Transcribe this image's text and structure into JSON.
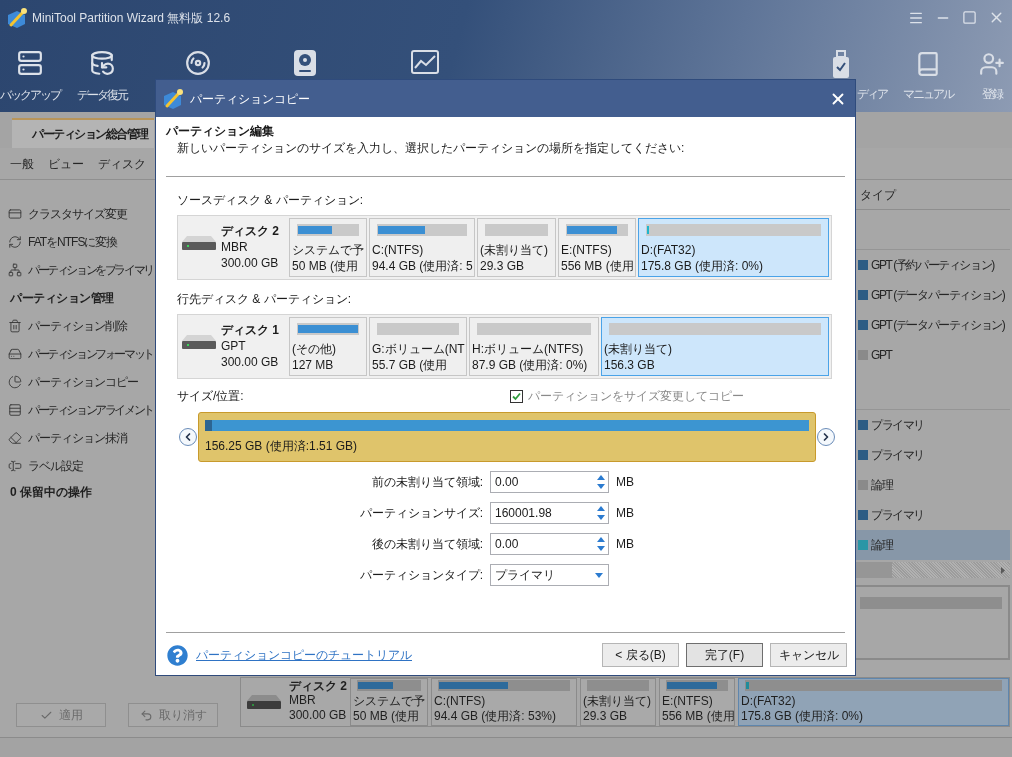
{
  "window": {
    "title": "MiniTool Partition Wizard 無料版 12.6"
  },
  "toolbar": {
    "left_items": [
      {
        "label": "バックアップ"
      },
      {
        "label": "データ復元"
      }
    ],
    "right_items": [
      {
        "label": "ディア"
      },
      {
        "label": "マニュアル"
      },
      {
        "label": "登録"
      }
    ]
  },
  "tabs": [
    {
      "label": "パーティション総合管理",
      "selected": true
    }
  ],
  "menu": [
    "一般",
    "ビュー",
    "ディスク"
  ],
  "sidebar": {
    "groups": [
      {
        "items": [
          "クラスタサイズ変更",
          "FATをNTFSに変換",
          "パーティションをプライマリ"
        ]
      },
      {
        "title": "パーティション管理",
        "items": [
          "パーティション削除",
          "パーティションフォーマット",
          "パーティションコピー",
          "パーティションアライメント",
          "パーティション抹消",
          "ラベル設定"
        ]
      }
    ],
    "pending_operations": "0 保留中の操作",
    "buttons": [
      {
        "kind": "apply",
        "label": "適用",
        "disabled": true
      },
      {
        "kind": "undo",
        "label": "取り消す",
        "disabled": true
      }
    ]
  },
  "partition_table": {
    "column": "タイプ",
    "disks": [
      {
        "rows": [
          {
            "type": "GPT (予約パーティション)",
            "color": "#2c5c84",
            "selected": false
          },
          {
            "type": "GPT (データパーティション)",
            "color": "#2c5c84",
            "selected": false
          },
          {
            "type": "GPT (データパーティション)",
            "color": "#2c5c84",
            "selected": false
          },
          {
            "type": "GPT",
            "color": "#8a8a8a",
            "selected": false
          }
        ]
      },
      {
        "rows": [
          {
            "type": "プライマリ",
            "color": "#2c5c84",
            "selected": false
          },
          {
            "type": "プライマリ",
            "color": "#2c5c84",
            "selected": false
          },
          {
            "type": "論理",
            "color": "#8a8a8a",
            "selected": false
          },
          {
            "type": "プライマリ",
            "color": "#2c5c84",
            "selected": false
          },
          {
            "type": "論理",
            "color": "#2a96a6",
            "selected": true
          }
        ]
      }
    ]
  },
  "disk_map": {
    "disk": {
      "name": "ディスク 2",
      "scheme": "MBR",
      "size": "300.00 GB"
    },
    "partitions": [
      {
        "name": "システムで予",
        "detail": "50 MB (使用",
        "level": 0.56,
        "color": "#2d6a9b",
        "selected": false
      },
      {
        "name": "C:(NTFS)",
        "detail": "94.4 GB (使用済: 53%)",
        "level": 0.53,
        "color": "#2d6a9b",
        "selected": false
      },
      {
        "name": "(未割り当て)",
        "detail": "29.3 GB",
        "selected": false
      },
      {
        "name": "E:(NTFS)",
        "detail": "556 MB (使用",
        "level": 0.83,
        "color": "#2d6a9b",
        "selected": false
      },
      {
        "name": "D:(FAT32)",
        "detail": "175.8 GB (使用済: 0%)",
        "level": 0.01,
        "color": "#1f8c9c",
        "selected": true
      }
    ]
  },
  "dialog": {
    "title": "パーティションコピー",
    "heading": "パーティション編集",
    "instruction": "新しいパーティションのサイズを入力し、選択したパーティションの場所を指定してください:",
    "source": {
      "label": "ソースディスク & パーティション:",
      "disk": {
        "name": "ディスク 2",
        "scheme": "MBR",
        "size": "300.00 GB"
      },
      "partitions": [
        {
          "name": "システムで予",
          "detail": "50 MB (使用",
          "level": 0.56,
          "color": "#3b8fd3",
          "selected": false
        },
        {
          "name": "C:(NTFS)",
          "detail": "94.4 GB (使用済: 5",
          "level": 0.53,
          "color": "#3b8fd3",
          "selected": false
        },
        {
          "name": "(未割り当て)",
          "detail": "29.3 GB",
          "selected": false
        },
        {
          "name": "E:(NTFS)",
          "detail": "556 MB (使用",
          "level": 0.83,
          "color": "#3b8fd3",
          "selected": false
        },
        {
          "name": "D:(FAT32)",
          "detail": "175.8 GB (使用済: 0%)",
          "level": 0.01,
          "color": "#1fb6cc",
          "selected": true
        }
      ]
    },
    "destination": {
      "label": "行先ディスク & パーティション:",
      "disk": {
        "name": "ディスク 1",
        "scheme": "GPT",
        "size": "300.00 GB"
      },
      "partitions": [
        {
          "name": "(その他)",
          "detail": "127 MB",
          "level": 1,
          "color": "#3b8fd3",
          "selected": false
        },
        {
          "name": "G:ボリューム(NT",
          "detail": "55.7 GB (使用",
          "selected": false
        },
        {
          "name": "H:ボリューム(NTFS)",
          "detail": "87.9 GB (使用済: 0%)",
          "selected": false
        },
        {
          "name": "(未割り当て)",
          "detail": "156.3 GB",
          "selected": true
        }
      ]
    },
    "size_position": {
      "label": "サイズ/位置:",
      "resize_option": {
        "label": "パーティションをサイズ変更してコピー",
        "checked": true,
        "disabled": true
      },
      "bar": {
        "text": "156.25 GB (使用済:1.51 GB)",
        "level": 0.012
      }
    },
    "fields": [
      {
        "kind": "spin",
        "label": "前の未割り当て領域:",
        "value": "0.00",
        "unit": "MB"
      },
      {
        "kind": "spin",
        "label": "パーティションサイズ:",
        "value": "160001.98",
        "unit": "MB"
      },
      {
        "kind": "spin",
        "label": "後の未割り当て領域:",
        "value": "0.00",
        "unit": "MB"
      },
      {
        "kind": "select",
        "label": "パーティションタイプ:",
        "value": "プライマリ"
      }
    ],
    "help_link": "パーティションコピーのチュートリアル",
    "buttons": [
      {
        "label": "< 戻る(B)",
        "default": false
      },
      {
        "label": "完了(F)",
        "default": true
      },
      {
        "label": "キャンセル",
        "default": false
      }
    ]
  }
}
